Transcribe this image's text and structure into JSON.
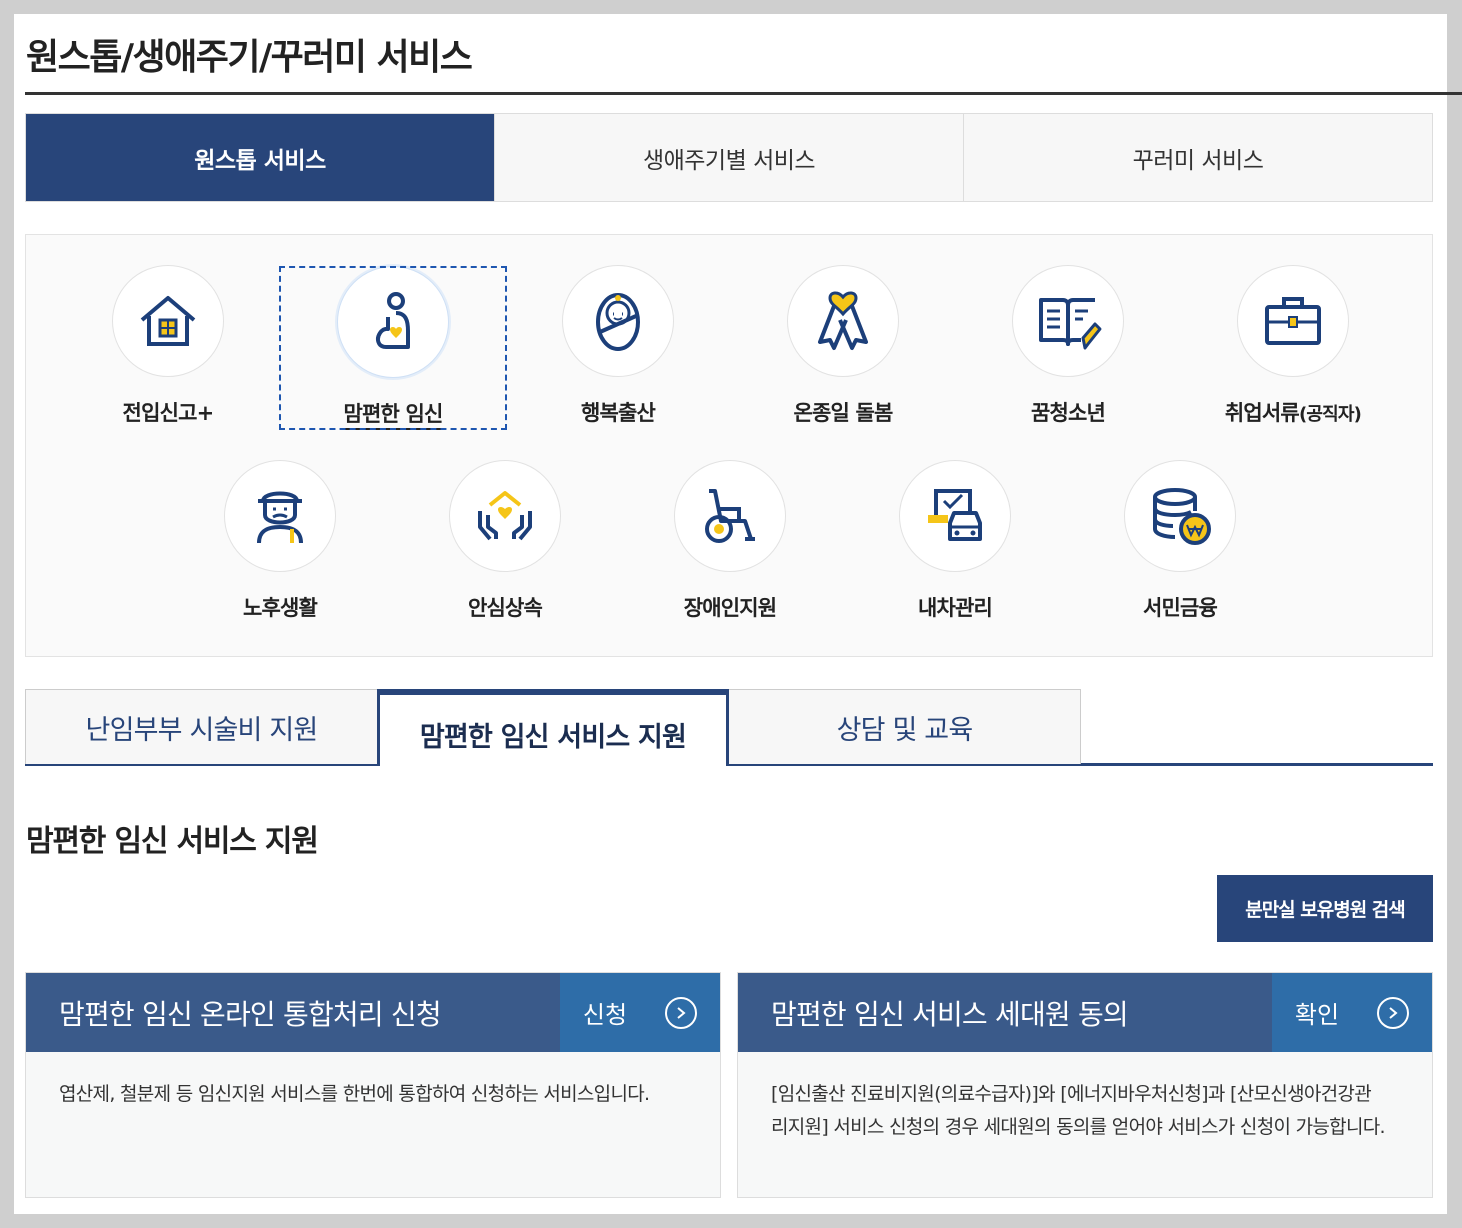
{
  "page": {
    "title": "원스톱/생애주기/꾸러미 서비스"
  },
  "main_tabs": [
    {
      "label": "원스톱 서비스",
      "active": true
    },
    {
      "label": "생애주기별 서비스",
      "active": false
    },
    {
      "label": "꾸러미 서비스",
      "active": false
    }
  ],
  "services": [
    {
      "label": "전입신고+",
      "icon": "house-icon"
    },
    {
      "label": "맘편한 임신",
      "icon": "pregnancy-icon",
      "focused": true
    },
    {
      "label": "행복출산",
      "icon": "baby-icon"
    },
    {
      "label": "온종일 돌봄",
      "icon": "ribbon-heart-icon"
    },
    {
      "label": "꿈청소년",
      "icon": "book-pencil-icon"
    },
    {
      "label": "취업서류",
      "label_small": "(공직자)",
      "icon": "briefcase-icon"
    },
    {
      "label": "노후생활",
      "icon": "elderly-icon"
    },
    {
      "label": "안심상속",
      "icon": "hands-home-icon"
    },
    {
      "label": "장애인지원",
      "icon": "wheelchair-icon"
    },
    {
      "label": "내차관리",
      "icon": "car-document-icon"
    },
    {
      "label": "서민금융",
      "icon": "coins-icon"
    }
  ],
  "sub_tabs": [
    {
      "label": "난임부부 시술비 지원",
      "active": false
    },
    {
      "label": "맘편한 임신 서비스 지원",
      "active": true
    },
    {
      "label": "상담 및 교육",
      "active": false
    }
  ],
  "section": {
    "title": "맘편한 임신 서비스 지원",
    "search_button": "분만실 보유병원 검색"
  },
  "cards": [
    {
      "title": "맘편한 임신 온라인 통합처리 신청",
      "action": "신청",
      "description": "엽산제, 철분제 등 임신지원 서비스를 한번에 통합하여 신청하는 서비스입니다."
    },
    {
      "title": "맘편한 임신 서비스 세대원 동의",
      "action": "확인",
      "description_lines": [
        "[임신출산 진료비지원(의료수급자)]와 [에너지바우처신청]과 [산모신생아건강관",
        "리지원] 서비스 신청의 경우 세대원의 동의를 얻어야 서비스가 신청이 가능합니다."
      ]
    }
  ],
  "colors": {
    "navy": "#28457a",
    "card_head": "#3a5a8a",
    "card_action": "#2e6da8",
    "icon_line": "#1c3f7a",
    "icon_accent": "#f5c518"
  }
}
